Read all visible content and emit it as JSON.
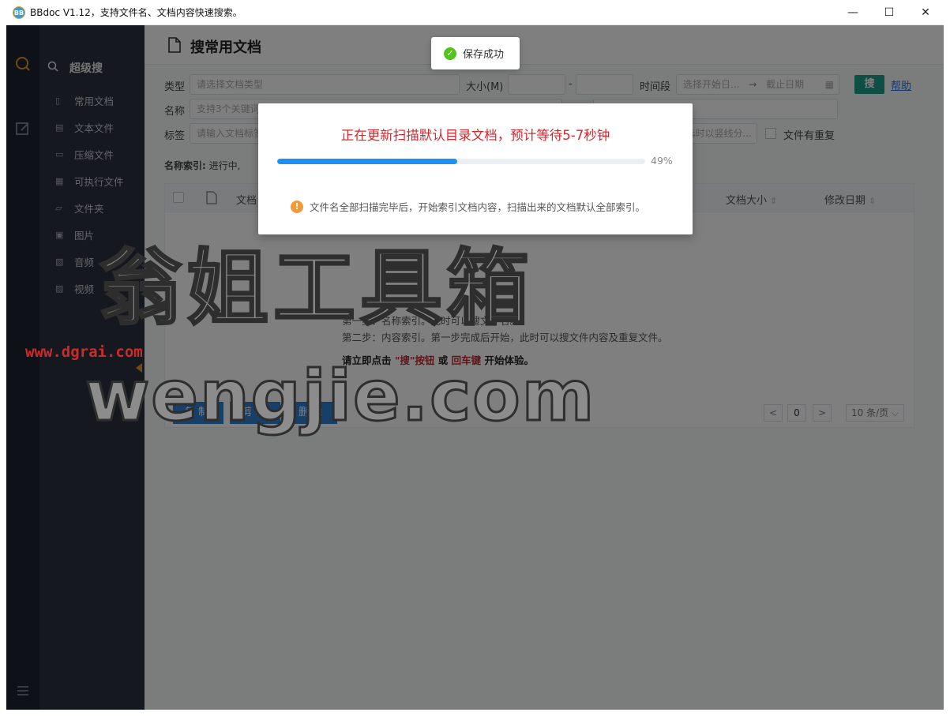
{
  "window": {
    "title": "BBdoc V1.12，支持文件名、文档内容快速搜索。",
    "logo_text": "BB",
    "minimize": "—",
    "maximize": "☐",
    "close": "✕"
  },
  "sidebar": {
    "header": "超级搜",
    "items": [
      {
        "label": "常用文档",
        "icon": "document-icon"
      },
      {
        "label": "文本文件",
        "icon": "text-file-icon"
      },
      {
        "label": "压缩文件",
        "icon": "archive-icon"
      },
      {
        "label": "可执行文件",
        "icon": "executable-icon"
      },
      {
        "label": "文件夹",
        "icon": "folder-icon"
      },
      {
        "label": "图片",
        "icon": "image-icon"
      },
      {
        "label": "音频",
        "icon": "audio-icon"
      },
      {
        "label": "视频",
        "icon": "video-icon"
      }
    ]
  },
  "page": {
    "title": "搜常用文档"
  },
  "filters": {
    "type_label": "类型",
    "type_placeholder": "请选择文档类型",
    "size_label": "大小(M)",
    "size_sep": "-",
    "time_label": "时间段",
    "time_start": "选择开始日...",
    "time_arrow": "→",
    "time_end": "截止日期",
    "search_button": "搜",
    "help_link": "帮助",
    "name_label": "名称",
    "name_placeholder": "支持3个关键词",
    "tag_label": "标签",
    "tag_placeholder": "请输入文档标签",
    "tag_right_placeholder": "选时以竖线分...",
    "duplicate_label": "文件有重复"
  },
  "index_status": {
    "label": "名称索引:",
    "value": "进行中,"
  },
  "table": {
    "columns": [
      "文档",
      "文档大小",
      "修改日期"
    ],
    "sort_icon": "⇕"
  },
  "hints": {
    "step1": "第一步：名称索引。此时可以搜文件名。",
    "step2": "第二步：内容索引。第一步完成后开始，此时可以搜文件内容及重复文件。",
    "cta_prefix": "请立即点击",
    "cta_button": "\"搜\"按钮",
    "cta_or": "或",
    "cta_key": "回车键",
    "cta_suffix": "开始体验。"
  },
  "actions": {
    "copy": "复制",
    "cut": "剪切",
    "delete": "删除"
  },
  "pager": {
    "prev": "<",
    "page": "0",
    "next": ">",
    "page_size": "10 条/页"
  },
  "toast": {
    "text": "保存成功"
  },
  "modal": {
    "title": "正在更新扫描默认目录文档，预计等待5-7秒钟",
    "progress": 0.49,
    "progress_text": "49%",
    "info": "文件名全部扫描完毕后，开始索引文档内容，扫描出来的文档默认全部索引。"
  },
  "watermark": {
    "line1": "翁姐工具箱",
    "url": "www.dgrai.com",
    "line2": "wengjie.com"
  }
}
